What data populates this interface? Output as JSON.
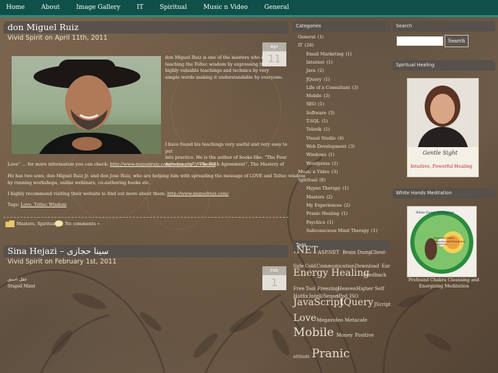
{
  "nav": {
    "items": [
      "Home",
      "About",
      "Image Gallery",
      "IT",
      "Spiritual",
      "Music n Video",
      "General"
    ]
  },
  "posts": [
    {
      "title": "don Miguel Ruiz",
      "subtitle": "Vivid Spirit on April 11th, 2011",
      "date_month": "Apr",
      "date_day": "11",
      "intro_lines": [
        "don Miguel Ruiz is one of the masters who is",
        "teaching the Toltec wisdom by expressing the",
        "highly valuable teachings and technics by very",
        "simple words making it understandable by everyone."
      ],
      "para2_lines": [
        "I have found his teachings very useful and very easy to put",
        "into practice. He is the author of books like: “The Four",
        "Agreements”, “The Fifth Agreement”, The Mastery of"
      ],
      "para2_last": "Love” … for more information you can check: ",
      "para2_link": "http://www.miguelruiz.com/index.php?p=Books",
      "para3_lines": [
        "He has two sons, don Miguel Ruiz Jr. and don Jose Ruiz, who are helping him with spreading the message of LOVE and Toltec wisdom",
        "by running workshops, online webinars, co-authoring books etc."
      ],
      "para4_text": "I highly recommend visiting their website to find out more about them: ",
      "para4_link": "http://www.miguelruiz.com/",
      "tags_label": "Tags: ",
      "tags": "Love, Toltec Wisdom",
      "categories": "Masters, Spiritual",
      "comments": "No comments »"
    },
    {
      "title": "Sina Hejazi – سینا حجازی",
      "subtitle": "Vivid Spirit on February 1st, 2011",
      "date_month": "Feb",
      "date_day": "1",
      "line1": "عقل احمق",
      "line2": "Stupid Mind"
    }
  ],
  "sidebar": {
    "categories_title": "Categories",
    "categories": [
      {
        "label": "General",
        "count": "(1)",
        "level": 0
      },
      {
        "label": "IT",
        "count": "(26)",
        "level": 0
      },
      {
        "label": "Email Marketing",
        "count": "(1)",
        "level": 1
      },
      {
        "label": "Internet",
        "count": "(1)",
        "level": 1
      },
      {
        "label": "Java",
        "count": "(2)",
        "level": 1
      },
      {
        "label": "JQuery",
        "count": "(1)",
        "level": 1
      },
      {
        "label": "Life of a Consultant",
        "count": "(3)",
        "level": 1
      },
      {
        "label": "Mobile",
        "count": "(3)",
        "level": 1
      },
      {
        "label": "SEO",
        "count": "(1)",
        "level": 1
      },
      {
        "label": "Software",
        "count": "(3)",
        "level": 1
      },
      {
        "label": "T-SQL",
        "count": "(1)",
        "level": 1
      },
      {
        "label": "Telerik",
        "count": "(1)",
        "level": 1
      },
      {
        "label": "Visual Studio",
        "count": "(4)",
        "level": 1
      },
      {
        "label": "Web Development",
        "count": "(3)",
        "level": 1
      },
      {
        "label": "Windows",
        "count": "(1)",
        "level": 1
      },
      {
        "label": "Wordpress",
        "count": "(1)",
        "level": 1
      },
      {
        "label": "Music n Video",
        "count": "(3)",
        "level": 0
      },
      {
        "label": "Spiritual",
        "count": "(8)",
        "level": 0
      },
      {
        "label": "Hypno Therapy",
        "count": "(1)",
        "level": 1
      },
      {
        "label": "Masters",
        "count": "(2)",
        "level": 1
      },
      {
        "label": "My Experiences",
        "count": "(2)",
        "level": 1
      },
      {
        "label": "Pranic Healing",
        "count": "(1)",
        "level": 1
      },
      {
        "label": "Psychics",
        "count": "(1)",
        "level": 1
      },
      {
        "label": "Subconscious Mind Therapy",
        "count": "(1)",
        "level": 1
      }
    ],
    "tags_title": "Tags",
    "tags": [
      {
        "text": ".NET",
        "size": 14
      },
      {
        "text": "ASP.NET",
        "size": 7
      },
      {
        "text": "Brain Dump",
        "size": 7
      },
      {
        "text": "Client-",
        "size": 7
      },
      {
        "text": "Side",
        "size": 7
      },
      {
        "text": "Cold",
        "size": 7
      },
      {
        "text": "Communication",
        "size": 7
      },
      {
        "text": "Download",
        "size": 7
      },
      {
        "text": "Ear",
        "size": 7
      },
      {
        "text": "Energy Healing",
        "size": 14
      },
      {
        "text": "Feedback",
        "size": 7
      },
      {
        "text": "Free",
        "size": 7
      },
      {
        "text": "Tool",
        "size": 7
      },
      {
        "text": "Freezing",
        "size": 7
      },
      {
        "text": "Heaven",
        "size": 7
      },
      {
        "text": "Higher Self",
        "size": 7
      },
      {
        "text": "Hotfix",
        "size": 7
      },
      {
        "text": "IntelliSense",
        "size": 7
      },
      {
        "text": "iPod",
        "size": 7
      },
      {
        "text": "ISO",
        "size": 7
      },
      {
        "text": "JavaScript",
        "size": 14
      },
      {
        "text": "JQuery",
        "size": 14
      },
      {
        "text": "JScript",
        "size": 7
      },
      {
        "text": "Love",
        "size": 14
      },
      {
        "text": "Megavideo",
        "size": 7
      },
      {
        "text": "Metacafe",
        "size": 7
      },
      {
        "text": "Mobile",
        "size": 17
      },
      {
        "text": "Money",
        "size": 7
      },
      {
        "text": "Positive",
        "size": 7
      },
      {
        "text": "attitude",
        "size": 6
      },
      {
        "text": "Pranic",
        "size": 17
      }
    ],
    "search_title": "Search",
    "search_button": "Search",
    "search_value": "",
    "healing_title": "Spiritual Healing",
    "healing_card_script": "Gentle Sight",
    "healing_card_caption": "Intuitive, Powerful Healing",
    "meditation_title": "White Hands Meditation",
    "meditation_disc_title": "White Hands Meditation",
    "meditation_disc_sub": "Profound Chakra Cleansing and Energizing Meditation",
    "meditation_caption": "Profound Chakra Cleansing and Energizing Meditation"
  },
  "colors": {
    "nav_bg": "#0f5148",
    "nav_border": "#2c8a7e",
    "panel": "#55504c",
    "accent_red": "#b8262c"
  }
}
